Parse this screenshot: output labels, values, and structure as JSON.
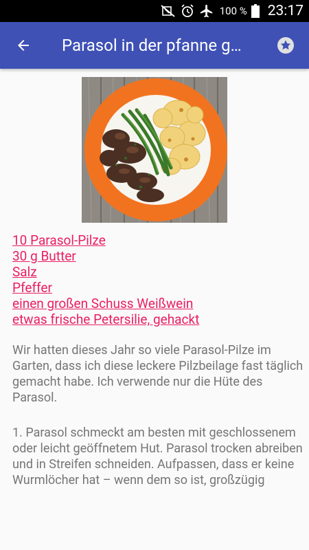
{
  "status_bar": {
    "battery": "100 %",
    "time": "23:17",
    "icons": [
      "mute-icon",
      "alarm-icon",
      "airplane-mode-icon",
      "battery-icon"
    ]
  },
  "app_bar": {
    "title": "Parasol in der pfanne g…",
    "back_icon": "arrow-back-icon",
    "favorite_icon": "star-icon",
    "color": "#3f51b5"
  },
  "recipe": {
    "image_alt": "Teller mit gebratenen Parasol-Pilzen, grünen Bohnen und Bratkartoffeln",
    "ingredients": [
      "10 Parasol-Pilze",
      "30 g Butter",
      "Salz",
      "Pfeffer",
      "einen großen Schuss Weißwein",
      "etwas frische Petersilie, gehackt"
    ],
    "link_color": "#e91e63",
    "description": "Wir hatten dieses Jahr so viele Parasol-Pilze im Garten, dass ich diese leckere Pilzbeilage fast täglich gemacht habe. Ich verwende nur die Hüte des Parasol.",
    "step_1": "1. Parasol schmeckt am besten mit geschlossenem oder leicht geöffnetem Hut. Parasol trocken abreiben und in Streifen schneiden. Aufpassen, dass er keine Wurmlöcher hat – wenn dem so ist, großzügig"
  }
}
